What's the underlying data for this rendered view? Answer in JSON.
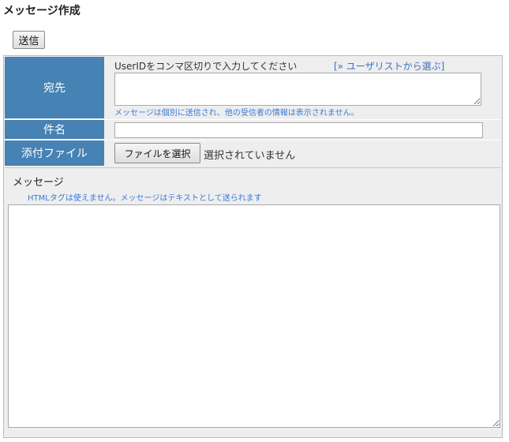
{
  "page": {
    "title": "メッセージ作成"
  },
  "toolbar": {
    "send_label": "送信"
  },
  "form": {
    "to": {
      "label": "宛先",
      "hint": "UserIDをコンマ区切りで入力してください",
      "user_list_link": "[» ユーザリストから選ぶ]",
      "value": "",
      "note": "メッセージは個別に送信され、他の受信者の情報は表示されません。"
    },
    "subject": {
      "label": "件名",
      "value": ""
    },
    "attachment": {
      "label": "添付ファイル",
      "button_label": "ファイルを選択",
      "status": "選択されていません"
    },
    "message": {
      "label": "メッセージ",
      "note": "HTMLタグは使えません。メッセージはテキストとして送られます",
      "value": ""
    }
  },
  "colors": {
    "label_bg": "#4682b4",
    "link": "#3a6fc4",
    "hint_blue": "#3a7ad6",
    "form_bg": "#eeeeee"
  }
}
